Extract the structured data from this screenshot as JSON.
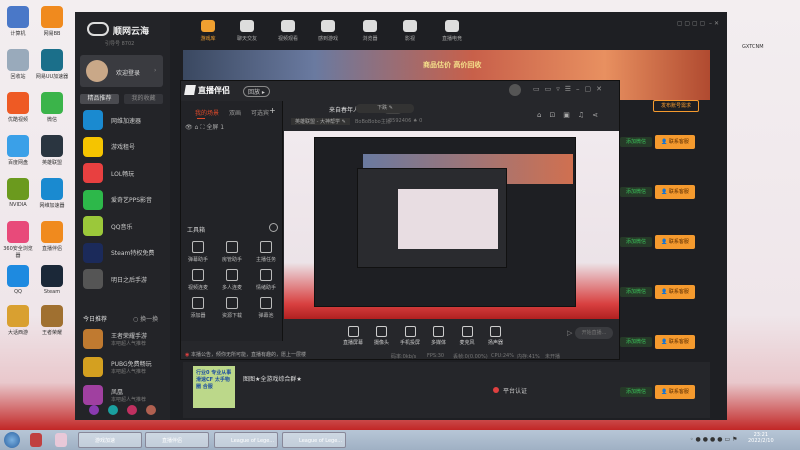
{
  "desktop": {
    "icons": [
      {
        "label": "计算机",
        "color": "#4a78c8"
      },
      {
        "label": "网易BB",
        "color": "#f08a1e"
      },
      {
        "label": "回收站",
        "color": "#9ab"
      },
      {
        "label": "网易UU加速器",
        "color": "#1b6f8a"
      },
      {
        "label": "优酷视频",
        "color": "#ee5a24"
      },
      {
        "label": "微信",
        "color": "#3bb44a"
      },
      {
        "label": "百度网盘",
        "color": "#3aa0e8"
      },
      {
        "label": "英雄联盟",
        "color": "#2a3540"
      },
      {
        "label": "NVIDIA",
        "color": "#6b9a1e"
      },
      {
        "label": "网维加速器",
        "color": "#1a8ad0"
      },
      {
        "label": "360安全浏览器",
        "color": "#e84a7a"
      },
      {
        "label": "直播伴侣",
        "color": "#f08a1e"
      },
      {
        "label": "QQ",
        "color": "#1e8ae0"
      },
      {
        "label": "Steam",
        "color": "#1b2838"
      },
      {
        "label": "大话西游",
        "color": "#d9a030"
      },
      {
        "label": "王者荣耀",
        "color": "#a07030"
      }
    ],
    "right_icon_label": "GXTCNM"
  },
  "app": {
    "logo": "顺网云海",
    "sub": "引导号 8702",
    "nav": [
      "游戏库",
      "聊天交友",
      "视频观看",
      "感到游戏",
      "浏览器",
      "影视",
      "直播电竞"
    ],
    "user": "欢迎登录",
    "tabs": [
      "精品推荐",
      "我的收藏"
    ],
    "apps": [
      {
        "label": "网维加速器",
        "color": "#1a8ad0"
      },
      {
        "label": "游戏租号",
        "color": "#f5c400"
      },
      {
        "label": "LOL畅玩",
        "color": "#e84040"
      },
      {
        "label": "爱奇艺PPS影音",
        "color": "#2db84a"
      },
      {
        "label": "QQ音乐",
        "color": "#9bc83a"
      },
      {
        "label": "Steam特权免费",
        "color": "#1b2a5a"
      },
      {
        "label": "明日之后手游",
        "color": "#555"
      }
    ],
    "today": "今日推荐",
    "refresh": "换一换",
    "recs": [
      {
        "title": "王者荣耀手游",
        "sub": "本吧超人气推荐",
        "color": "#c07a30"
      },
      {
        "title": "PUBG免费畅玩",
        "sub": "本吧超人气推荐",
        "color": "#d4a020"
      },
      {
        "title": "凤凰",
        "sub": "本吧超人气推荐",
        "color": "#a040a0"
      }
    ],
    "banner_text": "商品估价 高价回收",
    "publish": "发布账号需求",
    "wechat": "添加微信",
    "contact": "联系客服",
    "row": {
      "title": "图图★全游戏综合群★",
      "cert": "平台认证",
      "thumb": "行业0 专业从事 滑速CF 太手物圈 合服"
    }
  },
  "zb": {
    "title": "直播伴侣",
    "badge": "回放",
    "tabs": [
      "我的场景",
      "双画",
      "可选宾"
    ],
    "stream_title": "来自春年人LOL",
    "edit": "换武",
    "down": "下跌",
    "category": "英雄联盟 - 大神帮学",
    "anchor": "BoBoBobo主播",
    "room": "3592406",
    "hot": "0",
    "scene": "全屏 1",
    "toolbox": "工具箱",
    "tools": [
      "弹幕助手",
      "房管助手",
      "主播任务",
      "视频连麦",
      "多人连麦",
      "情绪助手",
      "添加器",
      "资源下载",
      "弹幕池"
    ],
    "bottom": [
      "直播屏幕",
      "摄像头",
      "手机投屏",
      "多媒体",
      "麦克风",
      "扬声器"
    ],
    "start": "开始直播...",
    "notice": "本播公告，倾你无所可能，直播有趣的，愿上一层楼",
    "stats": [
      "码率:0kb/s",
      "FPS:30",
      "丢帧:0(0.00%)",
      "CPU:24%",
      "内存:41%",
      "未开播"
    ]
  },
  "taskbar": {
    "items": [
      "游戏加速",
      "直播伴侣",
      "League of Lege...",
      "League of Lege..."
    ],
    "time": "23:21",
    "date": "2022/2/10"
  }
}
